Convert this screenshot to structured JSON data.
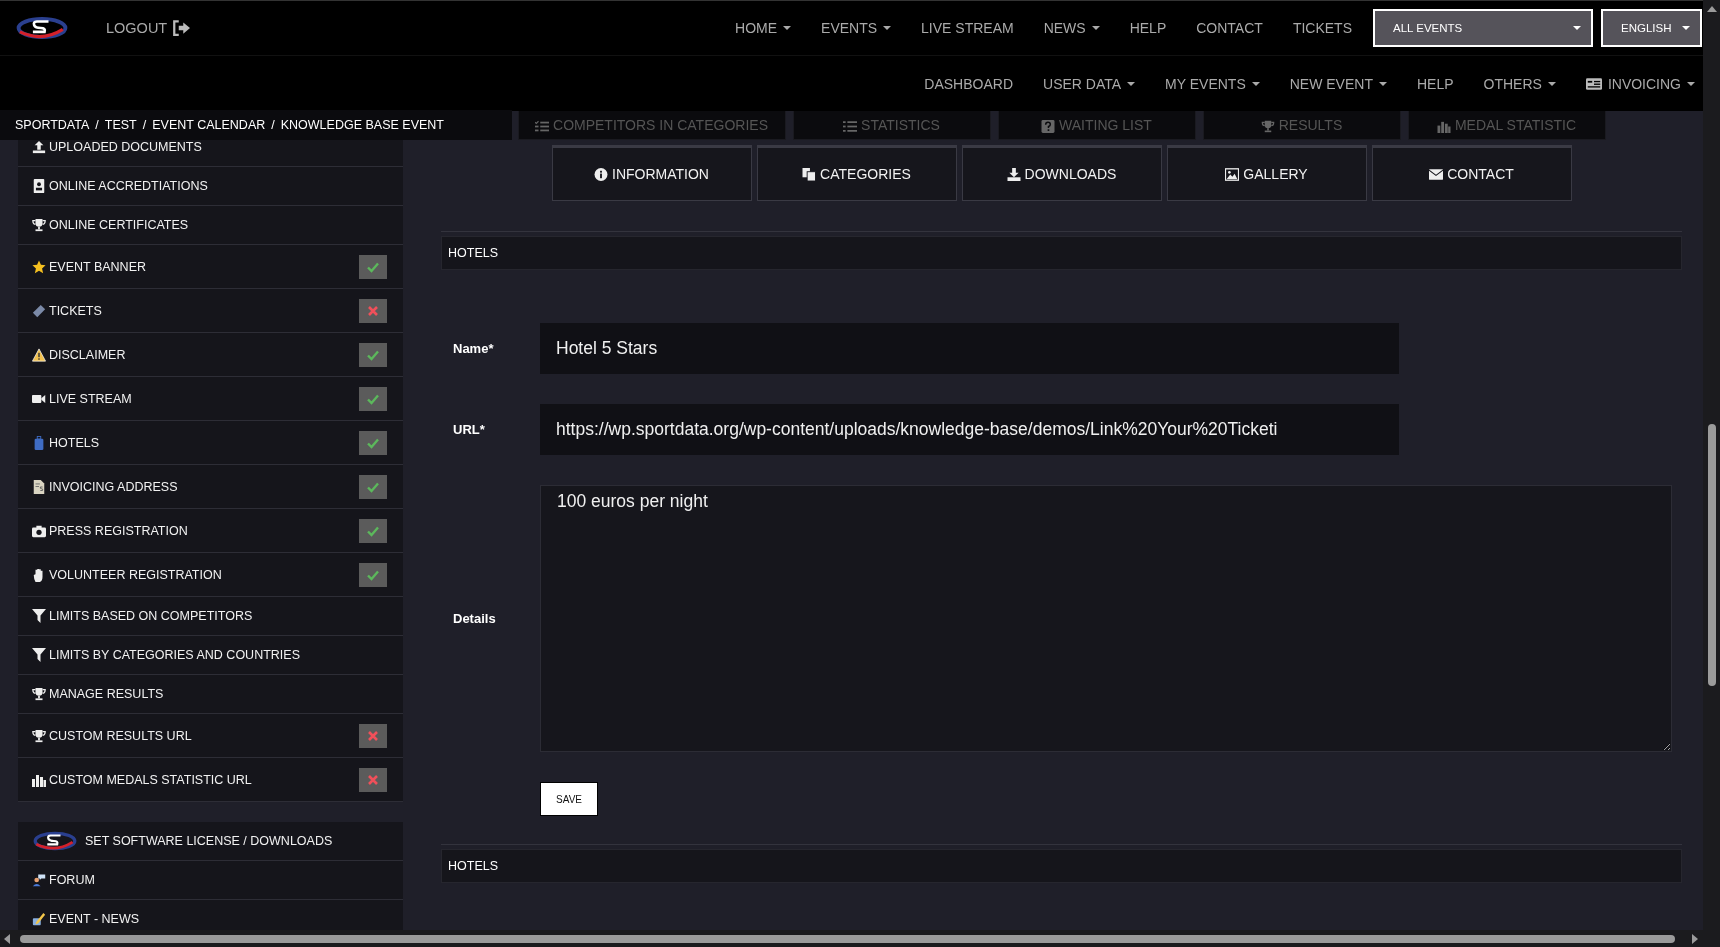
{
  "header": {
    "logout": "LOGOUT",
    "nav": [
      {
        "label": "HOME",
        "dropdown": true
      },
      {
        "label": "EVENTS",
        "dropdown": true
      },
      {
        "label": "LIVE STREAM",
        "dropdown": false
      },
      {
        "label": "NEWS",
        "dropdown": true
      },
      {
        "label": "HELP",
        "dropdown": false
      },
      {
        "label": "CONTACT",
        "dropdown": false
      },
      {
        "label": "TICKETS",
        "dropdown": false
      }
    ],
    "event_select": "ALL EVENTS",
    "language_select": "ENGLISH"
  },
  "subnav": [
    {
      "label": "DASHBOARD",
      "dropdown": false
    },
    {
      "label": "USER DATA",
      "dropdown": true
    },
    {
      "label": "MY EVENTS",
      "dropdown": true
    },
    {
      "label": "NEW EVENT",
      "dropdown": true
    },
    {
      "label": "HELP",
      "dropdown": false
    },
    {
      "label": "OTHERS",
      "dropdown": true
    },
    {
      "label": "INVOICING",
      "dropdown": true
    }
  ],
  "breadcrumb": {
    "separator": "/",
    "items": [
      "SPORTDATA",
      "TEST",
      "EVENT CALENDAR",
      "KNOWLEDGE BASE EVENT"
    ]
  },
  "sidebar": {
    "groups": [
      {
        "items": [
          {
            "label": "UPLOADED DOCUMENTS"
          },
          {
            "label": "ONLINE ACCREDTIATIONS"
          },
          {
            "label": "ONLINE CERTIFICATES"
          },
          {
            "label": "EVENT BANNER",
            "enabled": true
          },
          {
            "label": "TICKETS",
            "enabled": false
          },
          {
            "label": "DISCLAIMER",
            "enabled": true
          },
          {
            "label": "LIVE STREAM",
            "enabled": true
          },
          {
            "label": "HOTELS",
            "enabled": true
          },
          {
            "label": "INVOICING ADDRESS",
            "enabled": true
          },
          {
            "label": "PRESS REGISTRATION",
            "enabled": true
          },
          {
            "label": "VOLUNTEER REGISTRATION",
            "enabled": true
          },
          {
            "label": "LIMITS BASED ON COMPETITORS"
          },
          {
            "label": "LIMITS BY CATEGORIES AND COUNTRIES"
          },
          {
            "label": "MANAGE RESULTS"
          },
          {
            "label": "CUSTOM RESULTS URL",
            "enabled": false
          },
          {
            "label": "CUSTOM MEDALS STATISTIC URL",
            "enabled": false
          }
        ]
      },
      {
        "items": [
          {
            "label": "SET SOFTWARE LICENSE / DOWNLOADS"
          },
          {
            "label": "FORUM"
          },
          {
            "label": "EVENT - NEWS"
          }
        ]
      }
    ]
  },
  "event_tabs_upper": [
    "COMPETITORS IN CATEGORIES",
    "STATISTICS",
    "WAITING LIST",
    "RESULTS",
    "MEDAL STATISTIC"
  ],
  "event_tabs": [
    "INFORMATION",
    "CATEGORIES",
    "DOWNLOADS",
    "GALLERY",
    "CONTACT"
  ],
  "section_title": "HOTELS",
  "form": {
    "fields": [
      {
        "kind": "input",
        "label": "Name*",
        "value": "Hotel 5 Stars"
      },
      {
        "kind": "input",
        "label": "URL*",
        "value": "https://wp.sportdata.org/wp-content/uploads/knowledge-base/demos/Link%20Your%20Ticketi"
      },
      {
        "kind": "textarea",
        "label": "Details",
        "value": "100 euros per night"
      }
    ],
    "save": "SAVE"
  },
  "footer_section_title": "HOTELS"
}
